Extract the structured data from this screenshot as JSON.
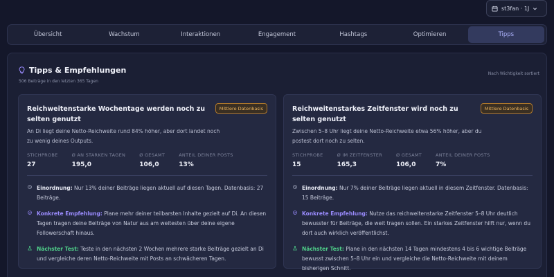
{
  "account": {
    "label": "st3fan · 1J",
    "icon": "calendar-icon",
    "chevron": "chevron-down-icon"
  },
  "tabs": [
    {
      "label": "Übersicht",
      "active": false
    },
    {
      "label": "Wachstum",
      "active": false
    },
    {
      "label": "Interaktionen",
      "active": false
    },
    {
      "label": "Engagement",
      "active": false
    },
    {
      "label": "Hashtags",
      "active": false
    },
    {
      "label": "Optimieren",
      "active": false
    },
    {
      "label": "Tipps",
      "active": true
    }
  ],
  "panel": {
    "title": "Tipps & Empfehlungen",
    "title_icon": "lightbulb-icon",
    "subtitle": "506 Beiträge in den letzten 365 Tagen",
    "sort_note": "Nach Wichtigkeit sortiert"
  },
  "cards": [
    {
      "title": "Reichweitenstarke Wochentage werden noch zu selten genutzt",
      "badge": "Mittlere Datenbasis",
      "description": "An Di liegt deine Netto-Reichweite rund 84% höher, aber dort landet noch zu wenig deines Outputs.",
      "stats": [
        {
          "label": "Stichprobe",
          "value": "27"
        },
        {
          "label": "Ø an starken Tagen",
          "value": "195,0"
        },
        {
          "label": "Ø gesamt",
          "value": "106,0"
        },
        {
          "label": "Anteil deiner Posts",
          "value": "13%"
        }
      ],
      "rows": [
        {
          "icon": "clock-icon",
          "label": "Einordnung:",
          "text": " Nur 13% deiner Beiträge liegen aktuell auf diesen Tagen. Datenbasis: 27 Beiträge."
        },
        {
          "icon": "check-circle-icon",
          "label": "Konkrete Empfehlung:",
          "text": " Plane mehr deiner teilbarsten Inhalte gezielt auf Di. An diesen Tagen tragen deine Beiträge von Natur aus am weitesten über deine eigene Followerschaft hinaus."
        },
        {
          "icon": "flask-icon",
          "label": "Nächster Test:",
          "text": " Teste in den nächsten 2 Wochen mehrere starke Beiträge gezielt an Di und vergleiche deren Netto-Reichweite mit Posts an schwächeren Tagen."
        }
      ]
    },
    {
      "title": "Reichweitenstarkes Zeitfenster wird noch zu selten genutzt",
      "badge": "Mittlere Datenbasis",
      "description": "Zwischen 5–8 Uhr liegt deine Netto-Reichweite etwa 56% höher, aber du postest dort noch zu selten.",
      "stats": [
        {
          "label": "Stichprobe",
          "value": "15"
        },
        {
          "label": "Ø im Zeitfenster",
          "value": "165,3"
        },
        {
          "label": "Ø gesamt",
          "value": "106,0"
        },
        {
          "label": "Anteil deiner Posts",
          "value": "7%"
        }
      ],
      "rows": [
        {
          "icon": "clock-icon",
          "label": "Einordnung:",
          "text": " Nur 7% deiner Beiträge liegen aktuell in diesem Zeitfenster. Datenbasis: 15 Beiträge."
        },
        {
          "icon": "check-circle-icon",
          "label": "Konkrete Empfehlung:",
          "text": " Nutze das reichweitenstarke Zeitfenster 5–8 Uhr deutlich bewusster für Beiträge, die weit tragen sollen. Ein starkes Zeitfenster hilft nur, wenn du dort auch wirklich veröffentlichst."
        },
        {
          "icon": "flask-icon",
          "label": "Nächster Test:",
          "text": " Plane in den nächsten 14 Tagen mindestens 4 bis 6 wichtige Beiträge bewusst zwischen 5–8 Uhr ein und vergleiche die Netto-Reichweite mit deinem bisherigen Schnitt."
        }
      ]
    }
  ],
  "colors": {
    "accent": "#9b8cff",
    "badge": "#f0b860",
    "test": "#4fd08a"
  }
}
